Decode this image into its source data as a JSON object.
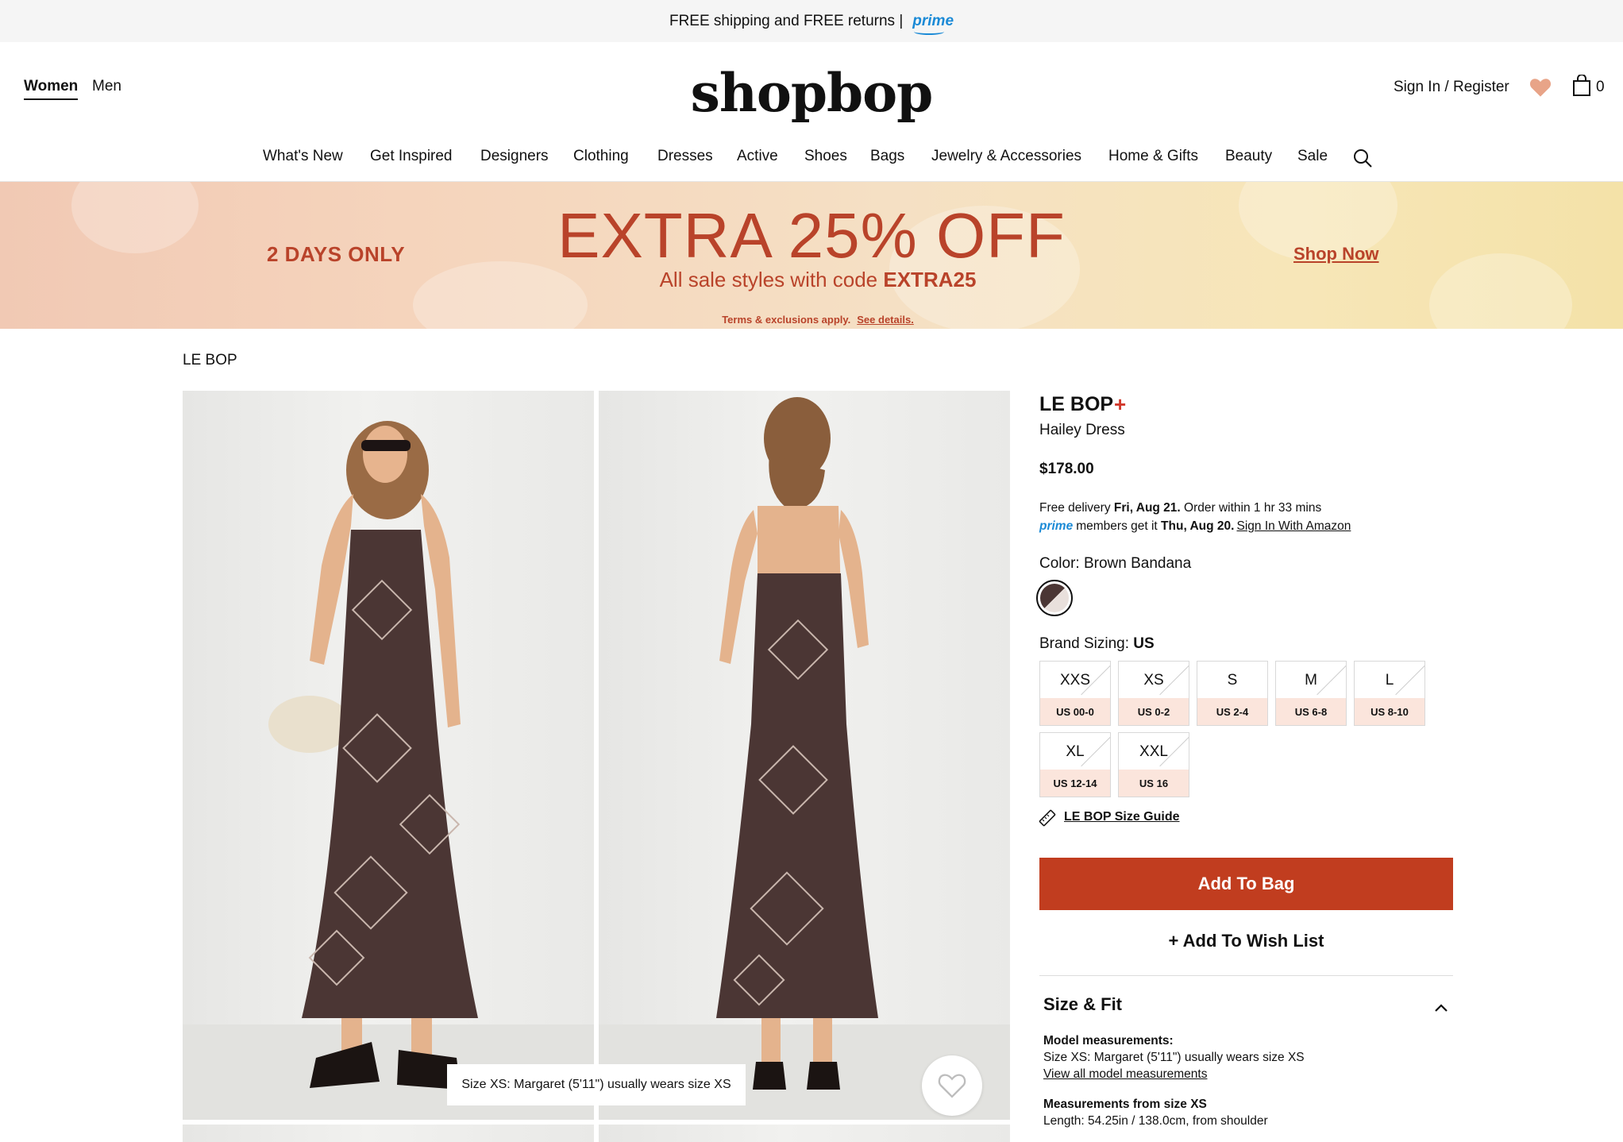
{
  "topbar": {
    "text": "FREE shipping and FREE returns |",
    "prime": "prime"
  },
  "header": {
    "women": "Women",
    "men": "Men",
    "logo": "shopbop",
    "signin": "Sign In / Register",
    "bag_count": "0"
  },
  "nav": [
    "What's New",
    "Get Inspired",
    "Designers",
    "Clothing",
    "Dresses",
    "Active",
    "Shoes",
    "Bags",
    "Jewelry & Accessories",
    "Home & Gifts",
    "Beauty",
    "Sale"
  ],
  "banner": {
    "days": "2 DAYS ONLY",
    "headline": "EXTRA 25% OFF",
    "sub_prefix": "All sale styles with code",
    "code": "EXTRA25",
    "terms": "Terms & exclusions apply.",
    "terms_link": "See details.",
    "cta": "Shop Now"
  },
  "breadcrumb": "LE BOP",
  "gallery": {
    "caption": "Size XS: Margaret (5'11\") usually wears size XS"
  },
  "product": {
    "brand": "LE BOP",
    "brand_plus": "+",
    "name": "Hailey Dress",
    "price": "$178.00",
    "delivery_prefix": "Free delivery",
    "delivery_date": "Fri, Aug 21.",
    "delivery_suffix": "Order within 1 hr 33 mins",
    "prime_logo": "prime",
    "prime_prefix": "members get it",
    "prime_date": "Thu, Aug 20.",
    "prime_link": "Sign In With Amazon",
    "color_label": "Color: Brown Bandana",
    "sizing_prefix": "Brand Sizing:",
    "sizing_value": "US",
    "sizes": [
      {
        "size": "XXS",
        "us": "US 00-0"
      },
      {
        "size": "XS",
        "us": "US 0-2"
      },
      {
        "size": "S",
        "us": "US 2-4"
      },
      {
        "size": "M",
        "us": "US 6-8"
      },
      {
        "size": "L",
        "us": "US 8-10"
      },
      {
        "size": "XL",
        "us": "US 12-14"
      },
      {
        "size": "XXL",
        "us": "US 16"
      }
    ],
    "size_guide": "LE BOP Size Guide",
    "add_to_bag": "Add To Bag",
    "wish_list": "+ Add To Wish List"
  },
  "size_fit": {
    "title": "Size & Fit",
    "model_head": "Model measurements:",
    "model_text": "Size XS: Margaret (5'11\") usually wears size XS",
    "model_link": "View all model measurements",
    "meas_head": "Measurements from size XS",
    "meas_text": "Length: 54.25in / 138.0cm, from shoulder"
  },
  "colors": {
    "accent": "#c13d1f",
    "banner_text": "#b9432a",
    "prime_blue": "#1b8ad6"
  }
}
